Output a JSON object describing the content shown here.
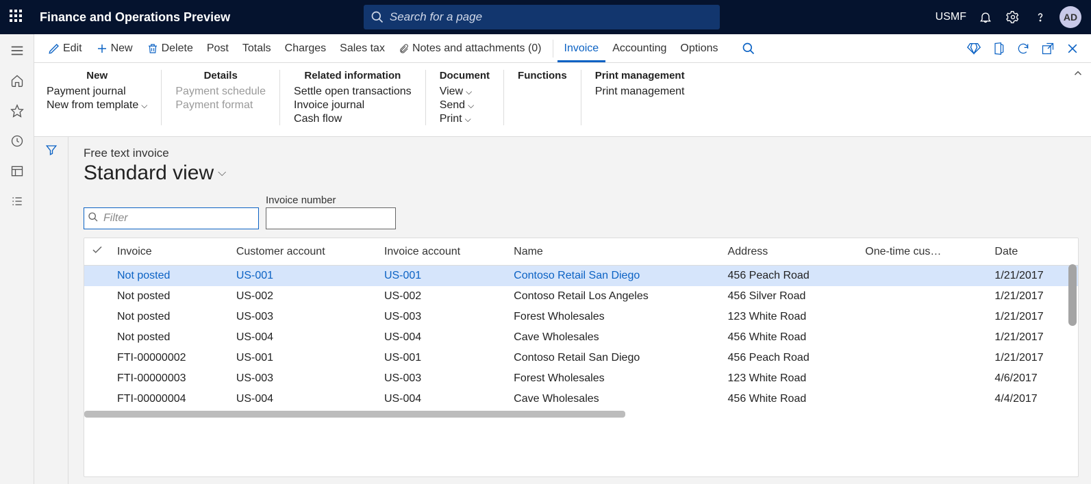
{
  "header": {
    "app_title": "Finance and Operations Preview",
    "search_placeholder": "Search for a page",
    "company": "USMF",
    "avatar": "AD"
  },
  "cmdbar": {
    "edit": "Edit",
    "new": "New",
    "delete": "Delete",
    "post": "Post",
    "totals": "Totals",
    "charges": "Charges",
    "salestax": "Sales tax",
    "notes": "Notes and attachments (0)",
    "invoice": "Invoice",
    "accounting": "Accounting",
    "options": "Options"
  },
  "ribbon": {
    "new": {
      "title": "New",
      "payment_journal": "Payment journal",
      "new_from_template": "New from template"
    },
    "details": {
      "title": "Details",
      "payment_schedule": "Payment schedule",
      "payment_format": "Payment format"
    },
    "related": {
      "title": "Related information",
      "settle": "Settle open transactions",
      "invoice_journal": "Invoice journal",
      "cash_flow": "Cash flow"
    },
    "document": {
      "title": "Document",
      "view": "View",
      "send": "Send",
      "print": "Print"
    },
    "functions": {
      "title": "Functions"
    },
    "printmgmt": {
      "title": "Print management",
      "item": "Print management"
    }
  },
  "page": {
    "breadcrumb": "Free text invoice",
    "view_name": "Standard view",
    "filter_placeholder": "Filter",
    "invoice_number_label": "Invoice number",
    "invoice_number_value": ""
  },
  "grid": {
    "columns": {
      "invoice": "Invoice",
      "customer_account": "Customer account",
      "invoice_account": "Invoice account",
      "name": "Name",
      "address": "Address",
      "one_time": "One-time cus…",
      "date": "Date"
    },
    "rows": [
      {
        "selected": true,
        "invoice": "Not posted",
        "all_link": true,
        "customer": "US-001",
        "inv_acct": "US-001",
        "name": "Contoso Retail San Diego",
        "address": "456 Peach Road",
        "date": "1/21/2017"
      },
      {
        "selected": false,
        "invoice": "Not posted",
        "all_link": false,
        "customer": "US-002",
        "inv_acct": "US-002",
        "name": "Contoso Retail Los Angeles",
        "address": "456 Silver Road",
        "date": "1/21/2017"
      },
      {
        "selected": false,
        "invoice": "Not posted",
        "all_link": false,
        "customer": "US-003",
        "inv_acct": "US-003",
        "name": "Forest Wholesales",
        "address": "123 White Road",
        "date": "1/21/2017"
      },
      {
        "selected": false,
        "invoice": "Not posted",
        "all_link": false,
        "customer": "US-004",
        "inv_acct": "US-004",
        "name": "Cave Wholesales",
        "address": "456 White Road",
        "date": "1/21/2017"
      },
      {
        "selected": false,
        "invoice": "FTI-00000002",
        "all_link": false,
        "customer": "US-001",
        "inv_acct": "US-001",
        "name": "Contoso Retail San Diego",
        "address": "456 Peach Road",
        "date": "1/21/2017"
      },
      {
        "selected": false,
        "invoice": "FTI-00000003",
        "all_link": false,
        "customer": "US-003",
        "inv_acct": "US-003",
        "name": "Forest Wholesales",
        "address": "123 White Road",
        "date": "4/6/2017"
      },
      {
        "selected": false,
        "invoice": "FTI-00000004",
        "all_link": false,
        "customer": "US-004",
        "inv_acct": "US-004",
        "name": "Cave Wholesales",
        "address": "456 White Road",
        "date": "4/4/2017"
      }
    ]
  }
}
